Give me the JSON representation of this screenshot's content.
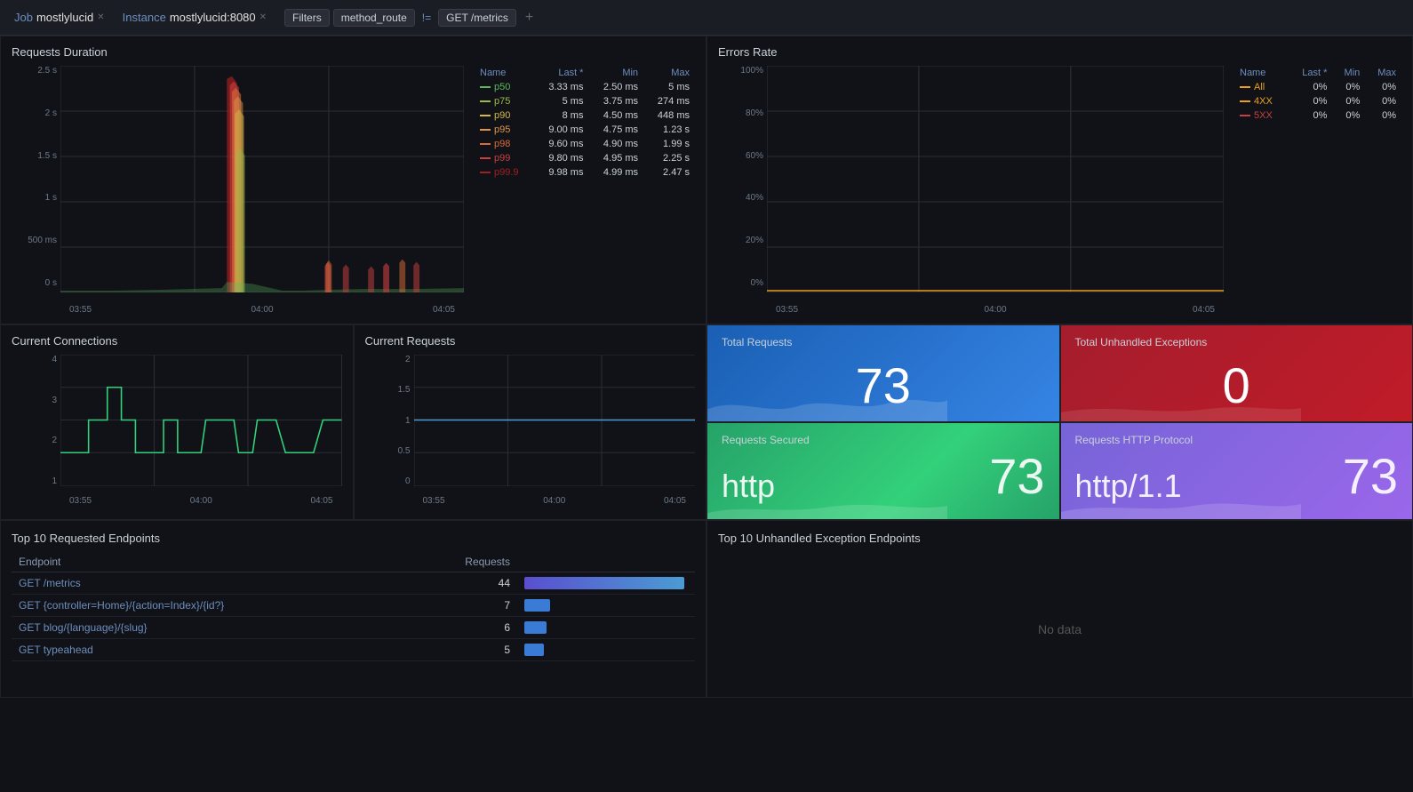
{
  "nav": {
    "job_label": "Job",
    "job_value": "mostlylucid",
    "instance_label": "Instance",
    "instance_value": "mostlylucid:8080",
    "filters_label": "Filters",
    "filter_key": "method_route",
    "filter_op": "!=",
    "filter_val": "GET /metrics",
    "add_icon": "+"
  },
  "req_duration": {
    "title": "Requests Duration",
    "y_labels": [
      "2.5 s",
      "2 s",
      "1.5 s",
      "1 s",
      "500 ms",
      "0 s"
    ],
    "x_labels": [
      "03:55",
      "04:00",
      "04:05"
    ],
    "legend": {
      "headers": [
        "Name",
        "Last *",
        "Min",
        "Max"
      ],
      "rows": [
        {
          "name": "p50",
          "color": "#5cb85c",
          "last": "3.33 ms",
          "min": "2.50 ms",
          "max": "5 ms"
        },
        {
          "name": "p75",
          "color": "#9cba4a",
          "last": "5 ms",
          "min": "3.75 ms",
          "max": "274 ms"
        },
        {
          "name": "p90",
          "color": "#d4b84a",
          "last": "8 ms",
          "min": "4.50 ms",
          "max": "448 ms"
        },
        {
          "name": "p95",
          "color": "#e0954a",
          "last": "9.00 ms",
          "min": "4.75 ms",
          "max": "1.23 s"
        },
        {
          "name": "p98",
          "color": "#d96b3a",
          "last": "9.60 ms",
          "min": "4.90 ms",
          "max": "1.99 s"
        },
        {
          "name": "p99",
          "color": "#c94040",
          "last": "9.80 ms",
          "min": "4.95 ms",
          "max": "2.25 s"
        },
        {
          "name": "p99.9",
          "color": "#a02020",
          "last": "9.98 ms",
          "min": "4.99 ms",
          "max": "2.47 s"
        }
      ]
    }
  },
  "errors_rate": {
    "title": "Errors Rate",
    "y_labels": [
      "100%",
      "80%",
      "60%",
      "40%",
      "20%",
      "0%"
    ],
    "x_labels": [
      "03:55",
      "04:00",
      "04:05"
    ],
    "legend": {
      "headers": [
        "Name",
        "Last *",
        "Min",
        "Max"
      ],
      "rows": [
        {
          "name": "All",
          "color": "#e8a020",
          "last": "0%",
          "min": "0%",
          "max": "0%"
        },
        {
          "name": "4XX",
          "color": "#e8a020",
          "last": "0%",
          "min": "0%",
          "max": "0%"
        },
        {
          "name": "5XX",
          "color": "#c94040",
          "last": "0%",
          "min": "0%",
          "max": "0%"
        }
      ]
    }
  },
  "current_connections": {
    "title": "Current Connections",
    "y_labels": [
      "4",
      "3",
      "2",
      "1"
    ],
    "x_labels": [
      "03:55",
      "04:00",
      "04:05"
    ]
  },
  "current_requests": {
    "title": "Current Requests",
    "y_labels": [
      "2",
      "1.5",
      "1",
      "0.5",
      "0"
    ],
    "x_labels": [
      "03:55",
      "04:00",
      "04:05"
    ]
  },
  "total_requests": {
    "title": "Total Requests",
    "value": "73"
  },
  "total_unhandled": {
    "title": "Total Unhandled Exceptions",
    "value": "0"
  },
  "requests_secured": {
    "title": "Requests Secured",
    "protocol": "http",
    "value": "73"
  },
  "requests_http_protocol": {
    "title": "Requests HTTP Protocol",
    "protocol": "http/1.1",
    "value": "73"
  },
  "top10_endpoints": {
    "title": "Top 10 Requested Endpoints",
    "col_endpoint": "Endpoint",
    "col_requests": "Requests",
    "rows": [
      {
        "endpoint": "GET /metrics",
        "count": "44",
        "bar_pct": 100
      },
      {
        "endpoint": "GET {controller=Home}/{action=Index}/{id?}",
        "count": "7",
        "bar_pct": 16
      },
      {
        "endpoint": "GET blog/{language}/{slug}",
        "count": "6",
        "bar_pct": 14
      },
      {
        "endpoint": "GET typeahead",
        "count": "5",
        "bar_pct": 12
      }
    ]
  },
  "top10_exceptions": {
    "title": "Top 10 Unhandled Exception Endpoints",
    "no_data": "No data"
  }
}
